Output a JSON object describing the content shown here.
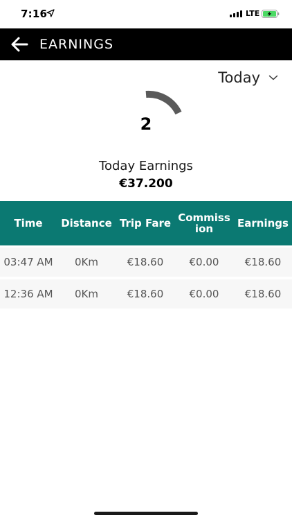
{
  "status_bar": {
    "time": "7:16",
    "network": "LTE"
  },
  "app_bar": {
    "title": "EARNINGS"
  },
  "period": {
    "selected": "Today"
  },
  "summary": {
    "trip_count": "2",
    "label": "Today Earnings",
    "total": "€37.200"
  },
  "table": {
    "headers": [
      "Time",
      "Distance",
      "Trip Fare",
      "Commiss ion",
      "Earnings"
    ],
    "header_lines": {
      "commission_line1": "Commiss",
      "commission_line2": "ion"
    },
    "rows": [
      [
        "03:47 AM",
        "0Km",
        "€18.60",
        "€0.00",
        "€18.60"
      ],
      [
        "12:36 AM",
        "0Km",
        "€18.60",
        "€0.00",
        "€18.60"
      ]
    ]
  },
  "colors": {
    "app_bar": "#000000",
    "table_header": "#0b7972",
    "gauge": "#5a5a5a",
    "row_background": "#f7f7f7"
  },
  "icons": {
    "back": "arrow-left-icon",
    "period": "chevron-down-icon",
    "location": "location-arrow-icon",
    "signal": "signal-icon",
    "battery": "battery-charging-icon"
  }
}
